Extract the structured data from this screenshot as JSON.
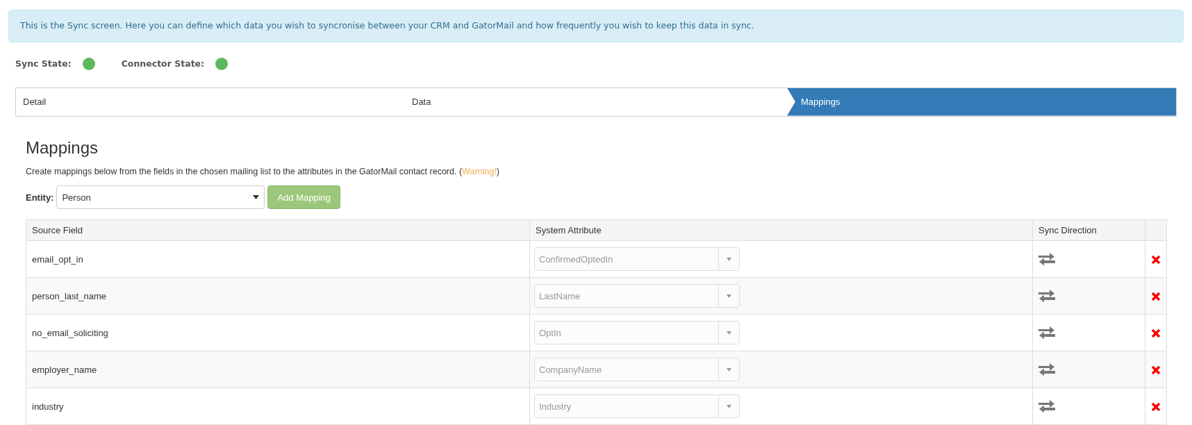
{
  "info_banner": "This is the Sync screen. Here you can define which data you wish to syncronise between your CRM and GatorMail and how frequently you wish to keep this data in sync.",
  "states": [
    {
      "label": "Sync State:",
      "color": "#5cb85c"
    },
    {
      "label": "Connector State:",
      "color": "#5cb85c"
    }
  ],
  "steps": [
    {
      "label": "Detail",
      "selected": false
    },
    {
      "label": "Data",
      "selected": false
    },
    {
      "label": "Mappings",
      "selected": true
    }
  ],
  "section": {
    "title": "Mappings",
    "description": "Create mappings below from the fields in the chosen mailing list to the attributes in the GatorMail contact record. (",
    "warning_link": "Warning!",
    "description_end": ")"
  },
  "entity": {
    "label": "Entity:",
    "value": "Person"
  },
  "add_button": "Add Mapping",
  "table": {
    "columns": [
      "Source Field",
      "System Attribute",
      "Sync Direction"
    ],
    "rows": [
      {
        "source": "email_opt_in",
        "attribute": "ConfirmedOptedIn"
      },
      {
        "source": "person_last_name",
        "attribute": "LastName"
      },
      {
        "source": "no_email_soliciting",
        "attribute": "OptIn"
      },
      {
        "source": "employer_name",
        "attribute": "CompanyName"
      },
      {
        "source": "industry",
        "attribute": "Industry"
      }
    ]
  }
}
